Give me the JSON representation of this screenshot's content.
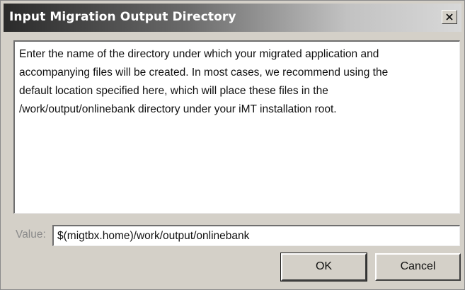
{
  "dialog": {
    "title": "Input Migration Output Directory",
    "close_icon": "close-icon",
    "message": "Enter the name of the directory under which your migrated application and\naccompanying files will be created.  In most cases, we recommend using the\ndefault location specified here, which will place these files in the\n/work/output/onlinebank directory under your iMT installation root.",
    "value_label": "Value:",
    "value": "$(migtbx.home)/work/output/onlinebank",
    "ok_label": "OK",
    "cancel_label": "Cancel"
  },
  "colors": {
    "dialog_background": "#d4d0c8",
    "title_text": "#ffffff",
    "value_label_text": "#8a8a8a"
  }
}
